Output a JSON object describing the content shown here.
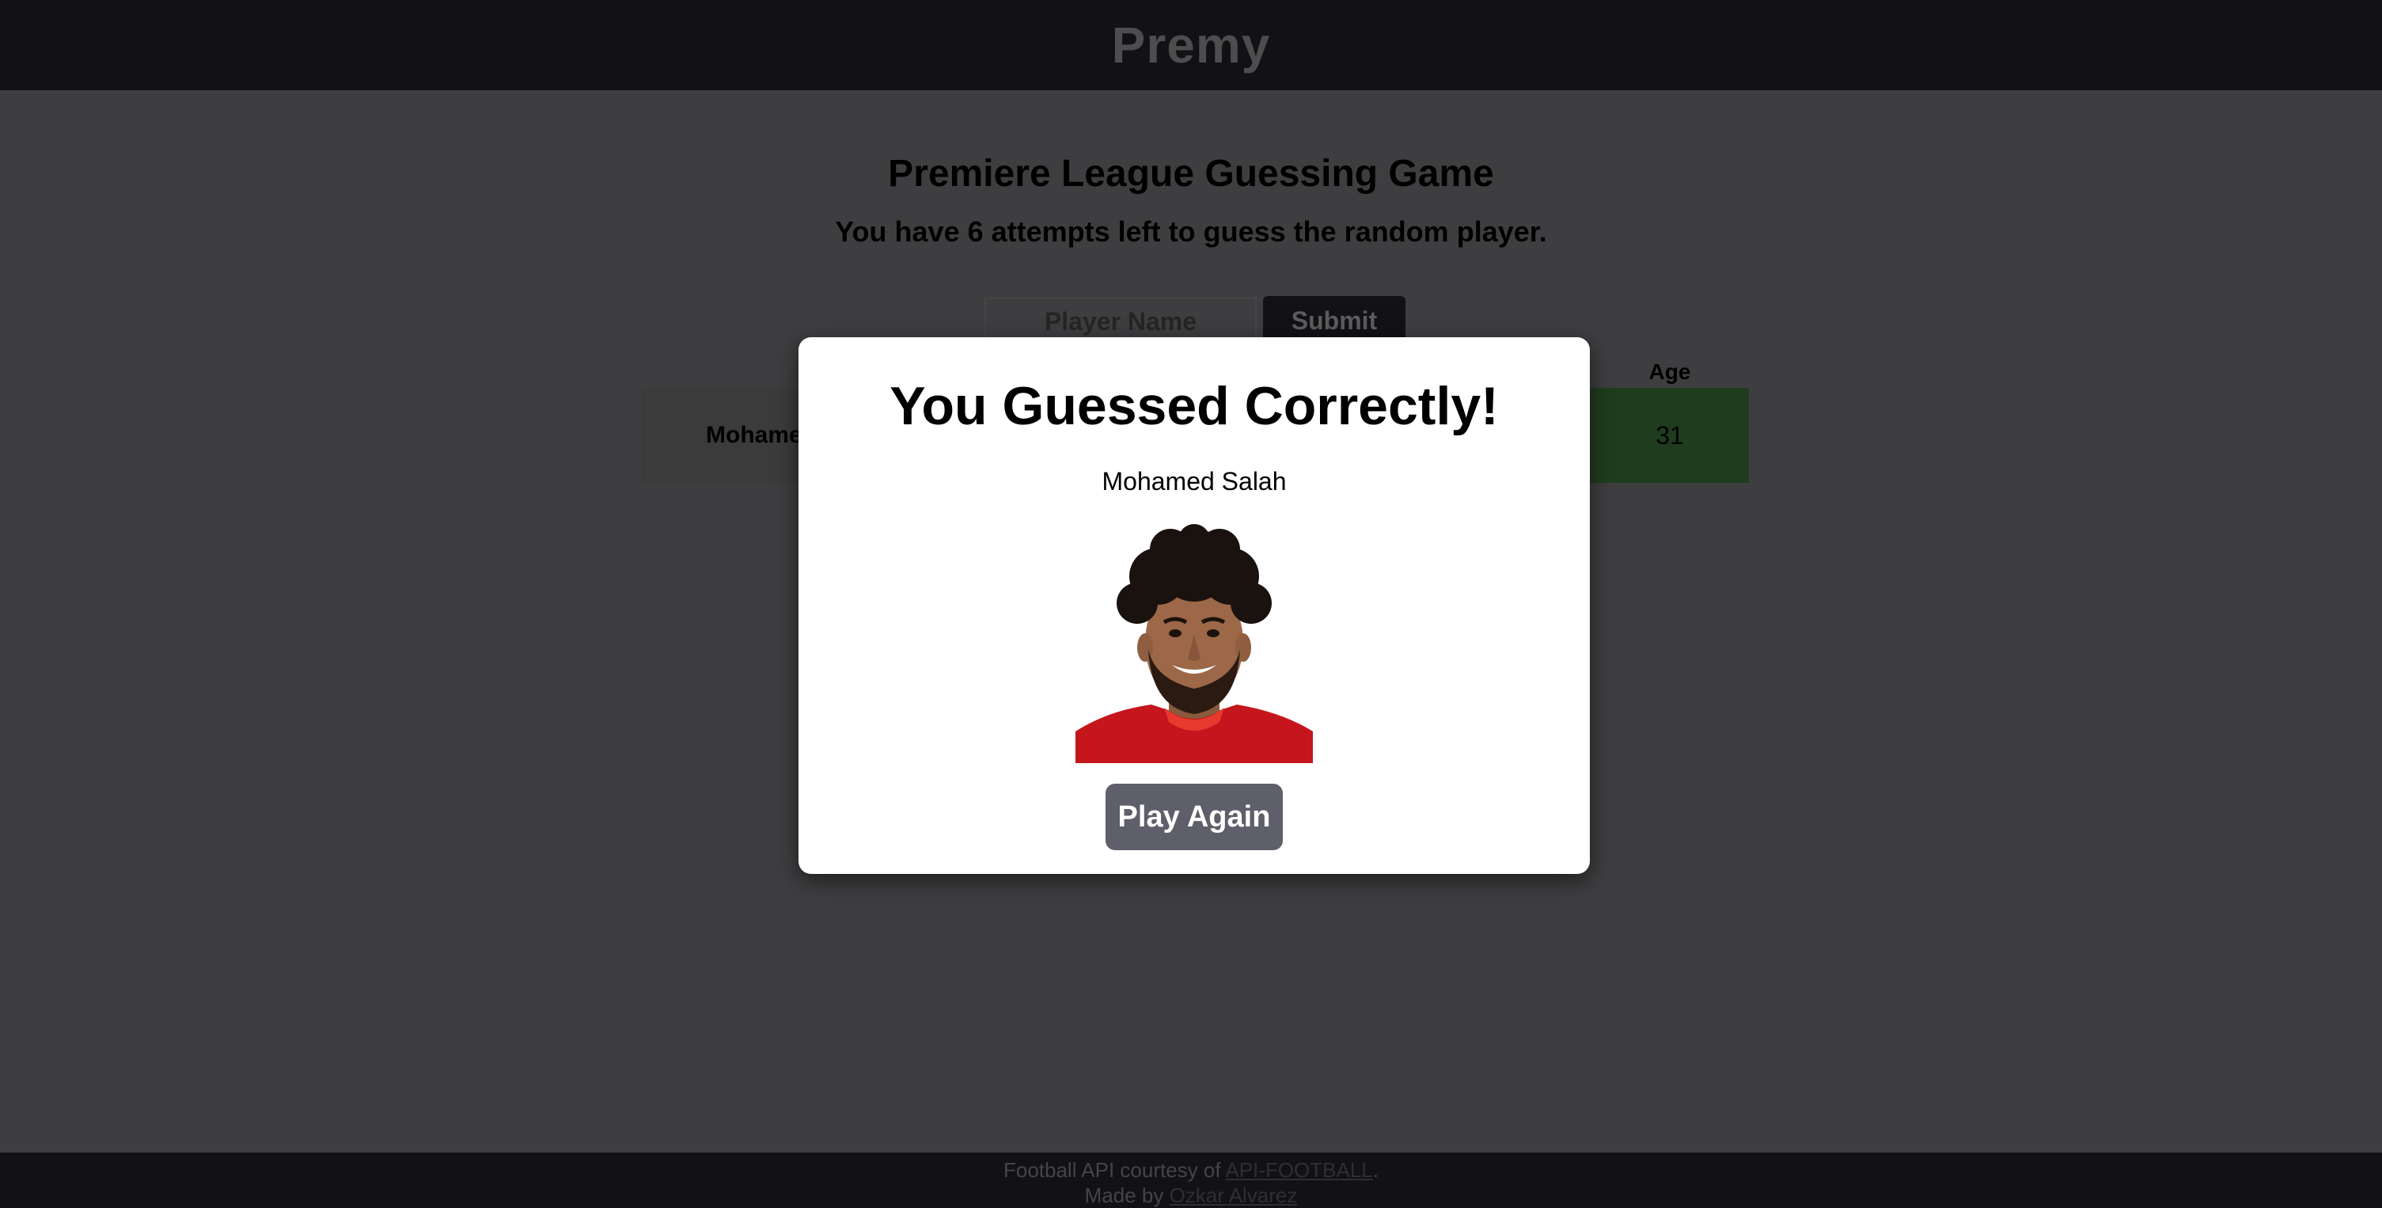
{
  "header": {
    "brand": "Premy"
  },
  "game": {
    "title": "Premiere League Guessing Game",
    "subtitle": "You have 6 attempts left to guess the random player.",
    "input_placeholder": "Player Name",
    "submit_label": "Submit",
    "columns": {
      "age": "Age"
    },
    "guesses": [
      {
        "name": "Mohamed Salah",
        "age": "31",
        "age_match": true
      }
    ]
  },
  "modal": {
    "title": "You Guessed Correctly!",
    "player_name": "Mohamed Salah",
    "play_again_label": "Play Again"
  },
  "footer": {
    "credit_prefix": "Football API courtesy of ",
    "credit_link": "API-FOOTBALL",
    "credit_suffix": ".",
    "made_by_prefix": "Made by ",
    "author_link": "Ozkar Alvarez"
  },
  "colors": {
    "header_bg": "#22222c",
    "correct_green": "#3e7a3d",
    "button_gray": "#5f5f6b"
  }
}
